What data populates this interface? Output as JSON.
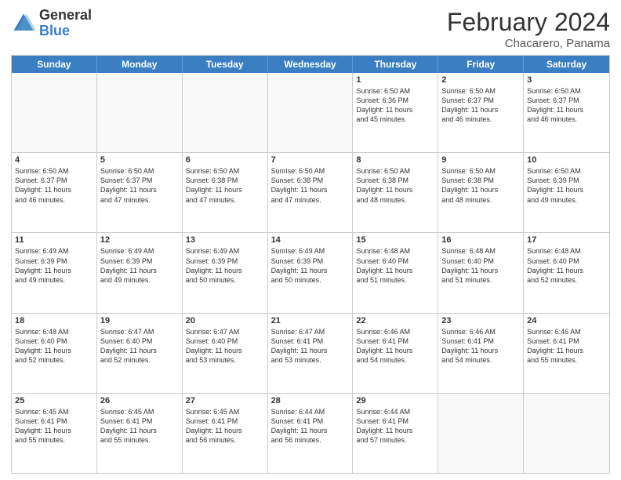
{
  "logo": {
    "general": "General",
    "blue": "Blue"
  },
  "title": "February 2024",
  "location": "Chacarero, Panama",
  "days_header": [
    "Sunday",
    "Monday",
    "Tuesday",
    "Wednesday",
    "Thursday",
    "Friday",
    "Saturday"
  ],
  "rows": [
    [
      {
        "day": "",
        "text": "",
        "empty": true
      },
      {
        "day": "",
        "text": "",
        "empty": true
      },
      {
        "day": "",
        "text": "",
        "empty": true
      },
      {
        "day": "",
        "text": "",
        "empty": true
      },
      {
        "day": "1",
        "text": "Sunrise: 6:50 AM\nSunset: 6:36 PM\nDaylight: 11 hours\nand 45 minutes."
      },
      {
        "day": "2",
        "text": "Sunrise: 6:50 AM\nSunset: 6:37 PM\nDaylight: 11 hours\nand 46 minutes."
      },
      {
        "day": "3",
        "text": "Sunrise: 6:50 AM\nSunset: 6:37 PM\nDaylight: 11 hours\nand 46 minutes."
      }
    ],
    [
      {
        "day": "4",
        "text": "Sunrise: 6:50 AM\nSunset: 6:37 PM\nDaylight: 11 hours\nand 46 minutes."
      },
      {
        "day": "5",
        "text": "Sunrise: 6:50 AM\nSunset: 6:37 PM\nDaylight: 11 hours\nand 47 minutes."
      },
      {
        "day": "6",
        "text": "Sunrise: 6:50 AM\nSunset: 6:38 PM\nDaylight: 11 hours\nand 47 minutes."
      },
      {
        "day": "7",
        "text": "Sunrise: 6:50 AM\nSunset: 6:38 PM\nDaylight: 11 hours\nand 47 minutes."
      },
      {
        "day": "8",
        "text": "Sunrise: 6:50 AM\nSunset: 6:38 PM\nDaylight: 11 hours\nand 48 minutes."
      },
      {
        "day": "9",
        "text": "Sunrise: 6:50 AM\nSunset: 6:38 PM\nDaylight: 11 hours\nand 48 minutes."
      },
      {
        "day": "10",
        "text": "Sunrise: 6:50 AM\nSunset: 6:39 PM\nDaylight: 11 hours\nand 49 minutes."
      }
    ],
    [
      {
        "day": "11",
        "text": "Sunrise: 6:49 AM\nSunset: 6:39 PM\nDaylight: 11 hours\nand 49 minutes."
      },
      {
        "day": "12",
        "text": "Sunrise: 6:49 AM\nSunset: 6:39 PM\nDaylight: 11 hours\nand 49 minutes."
      },
      {
        "day": "13",
        "text": "Sunrise: 6:49 AM\nSunset: 6:39 PM\nDaylight: 11 hours\nand 50 minutes."
      },
      {
        "day": "14",
        "text": "Sunrise: 6:49 AM\nSunset: 6:39 PM\nDaylight: 11 hours\nand 50 minutes."
      },
      {
        "day": "15",
        "text": "Sunrise: 6:48 AM\nSunset: 6:40 PM\nDaylight: 11 hours\nand 51 minutes."
      },
      {
        "day": "16",
        "text": "Sunrise: 6:48 AM\nSunset: 6:40 PM\nDaylight: 11 hours\nand 51 minutes."
      },
      {
        "day": "17",
        "text": "Sunrise: 6:48 AM\nSunset: 6:40 PM\nDaylight: 11 hours\nand 52 minutes."
      }
    ],
    [
      {
        "day": "18",
        "text": "Sunrise: 6:48 AM\nSunset: 6:40 PM\nDaylight: 11 hours\nand 52 minutes."
      },
      {
        "day": "19",
        "text": "Sunrise: 6:47 AM\nSunset: 6:40 PM\nDaylight: 11 hours\nand 52 minutes."
      },
      {
        "day": "20",
        "text": "Sunrise: 6:47 AM\nSunset: 6:40 PM\nDaylight: 11 hours\nand 53 minutes."
      },
      {
        "day": "21",
        "text": "Sunrise: 6:47 AM\nSunset: 6:41 PM\nDaylight: 11 hours\nand 53 minutes."
      },
      {
        "day": "22",
        "text": "Sunrise: 6:46 AM\nSunset: 6:41 PM\nDaylight: 11 hours\nand 54 minutes."
      },
      {
        "day": "23",
        "text": "Sunrise: 6:46 AM\nSunset: 6:41 PM\nDaylight: 11 hours\nand 54 minutes."
      },
      {
        "day": "24",
        "text": "Sunrise: 6:46 AM\nSunset: 6:41 PM\nDaylight: 11 hours\nand 55 minutes."
      }
    ],
    [
      {
        "day": "25",
        "text": "Sunrise: 6:45 AM\nSunset: 6:41 PM\nDaylight: 11 hours\nand 55 minutes."
      },
      {
        "day": "26",
        "text": "Sunrise: 6:45 AM\nSunset: 6:41 PM\nDaylight: 11 hours\nand 55 minutes."
      },
      {
        "day": "27",
        "text": "Sunrise: 6:45 AM\nSunset: 6:41 PM\nDaylight: 11 hours\nand 56 minutes."
      },
      {
        "day": "28",
        "text": "Sunrise: 6:44 AM\nSunset: 6:41 PM\nDaylight: 11 hours\nand 56 minutes."
      },
      {
        "day": "29",
        "text": "Sunrise: 6:44 AM\nSunset: 6:41 PM\nDaylight: 11 hours\nand 57 minutes."
      },
      {
        "day": "",
        "text": "",
        "empty": true
      },
      {
        "day": "",
        "text": "",
        "empty": true
      }
    ]
  ]
}
